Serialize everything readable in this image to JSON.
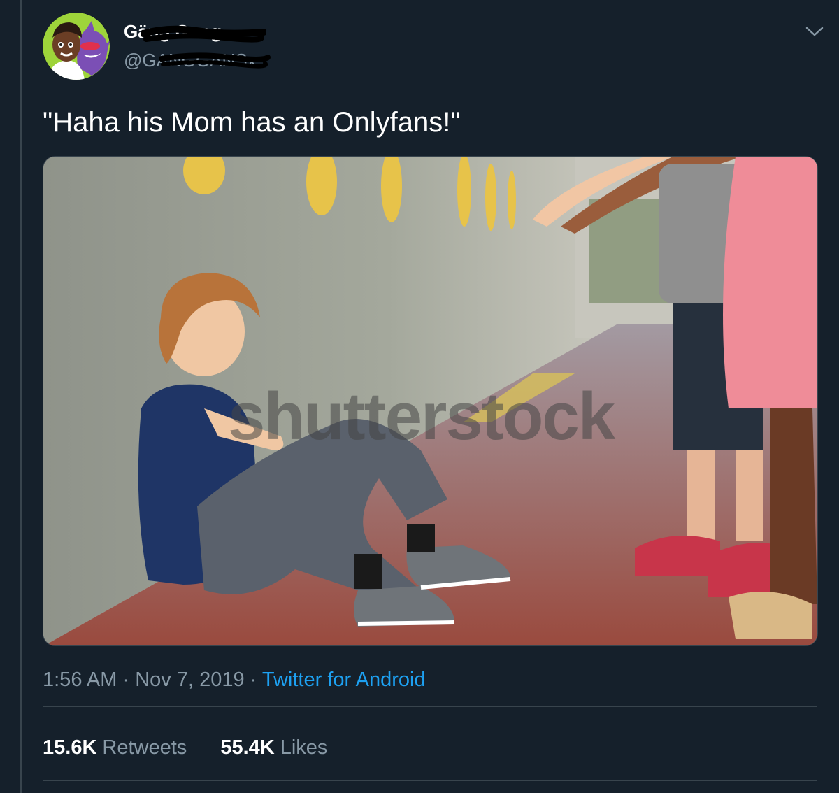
{
  "tweet": {
    "display_name": "Gäng Gang",
    "handle": "@GANGGANSx",
    "text": "\"Haha his Mom has an Onlyfans!\"",
    "time": "1:56 AM",
    "date": "Nov 7, 2019",
    "separator": "·",
    "source": "Twitter for Android",
    "media_watermark": "shutterstock",
    "retweets_count": "15.6K",
    "retweets_label": "Retweets",
    "likes_count": "55.4K",
    "likes_label": "Likes"
  },
  "icons": {
    "menu_caret": "chevron-down-icon",
    "avatar": "avatar"
  },
  "colors": {
    "background": "#15202b",
    "text_primary": "#ffffff",
    "text_secondary": "#8899a6",
    "link": "#1da1f2",
    "border": "#38444d"
  }
}
